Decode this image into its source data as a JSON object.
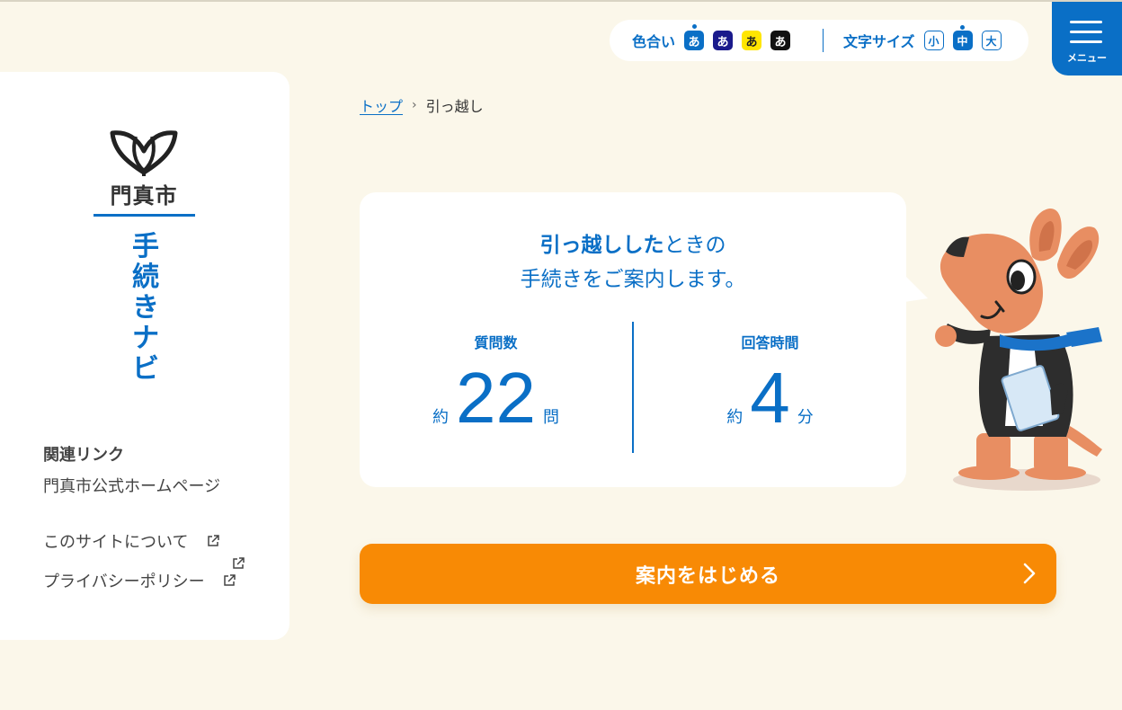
{
  "settings": {
    "color_label": "色合い",
    "color_options": [
      "あ",
      "あ",
      "あ",
      "あ"
    ],
    "size_label": "文字サイズ",
    "size_options": [
      "小",
      "中",
      "大"
    ]
  },
  "menu": {
    "label": "メニュー"
  },
  "sidebar": {
    "city_name": "門真市",
    "site_title": "手続きナビ",
    "related_title": "関連リンク",
    "links": [
      "門真市公式ホームページ",
      "このサイトについて",
      "プライバシーポリシー"
    ]
  },
  "breadcrumb": {
    "home": "トップ",
    "current": "引っ越し"
  },
  "intro": {
    "title_bold": "引っ越しした",
    "title_rest": "ときの",
    "title_line2": "手続きをご案内します。"
  },
  "stats": {
    "questions_label": "質問数",
    "questions_prefix": "約",
    "questions_value": "22",
    "questions_unit": "問",
    "time_label": "回答時間",
    "time_prefix": "約",
    "time_value": "4",
    "time_unit": "分"
  },
  "start_button": {
    "label": "案内をはじめる"
  },
  "colors": {
    "primary": "#0a6fc6",
    "accent": "#f88a05",
    "background": "#fbf7ea"
  }
}
